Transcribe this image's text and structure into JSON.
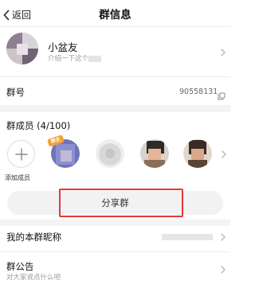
{
  "nav": {
    "back_label": "返回",
    "title": "群信息"
  },
  "group": {
    "name": "小盆友",
    "intro": "介绍一下这个"
  },
  "group_number": {
    "label": "群号",
    "value": "90558131"
  },
  "members": {
    "title": "群成员 (4/100)",
    "add_label": "添加成员",
    "owner_badge": "群主"
  },
  "share": {
    "label": "分享群"
  },
  "nickname": {
    "label": "我的本群昵称"
  },
  "notice": {
    "label": "群公告",
    "subtitle": "对大家说点什么吧"
  },
  "colors": {
    "highlight": "#e03a35",
    "owner_badge": "#f3a23a"
  }
}
